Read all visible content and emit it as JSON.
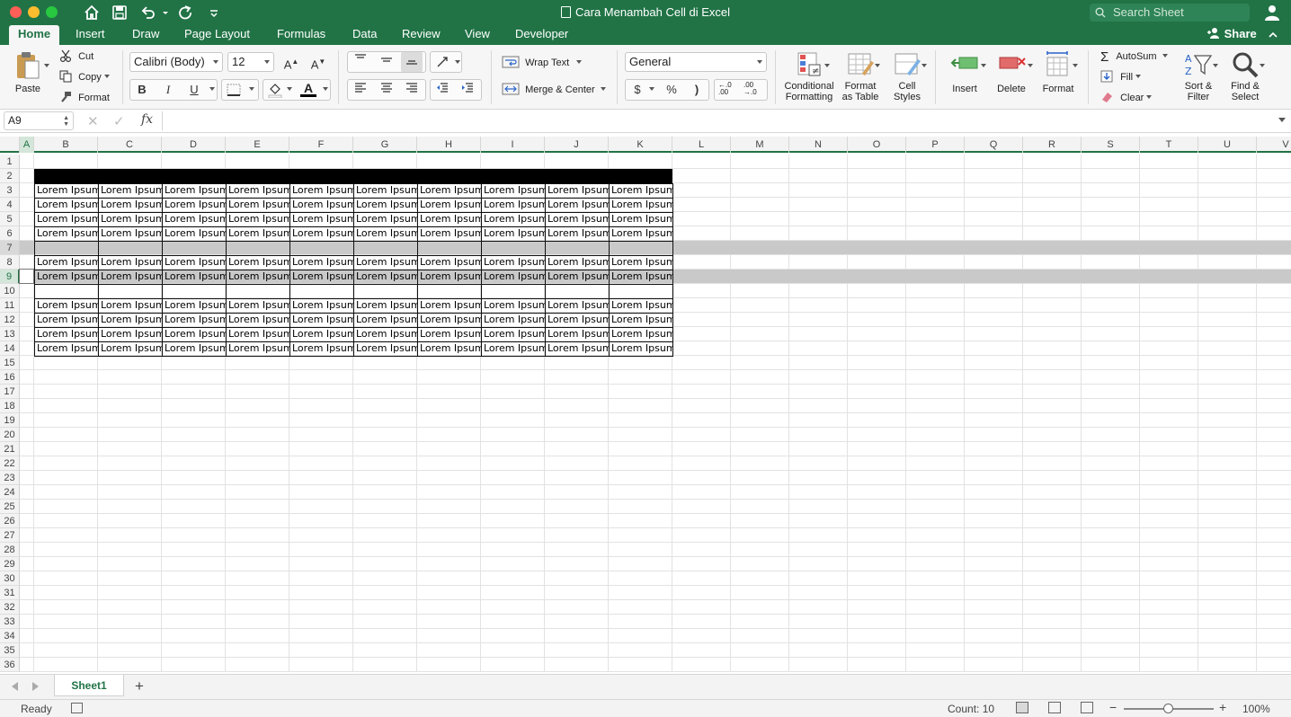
{
  "window": {
    "title": "Cara Menambah Cell di Excel",
    "search_placeholder": "Search Sheet"
  },
  "tabs": [
    "Home",
    "Insert",
    "Draw",
    "Page Layout",
    "Formulas",
    "Data",
    "Review",
    "View",
    "Developer"
  ],
  "share_label": "Share",
  "ribbon": {
    "paste": "Paste",
    "cut": "Cut",
    "copy": "Copy",
    "format_painter": "Format",
    "font_name": "Calibri (Body)",
    "font_size": "12",
    "bold": "B",
    "italic": "I",
    "underline": "U",
    "wrap_text": "Wrap Text",
    "merge_center": "Merge & Center",
    "number_format": "General",
    "currency": "$",
    "percent": "%",
    "comma": ")",
    "conditional_formatting": [
      "Conditional",
      "Formatting"
    ],
    "format_as_table": [
      "Format",
      "as Table"
    ],
    "cell_styles": [
      "Cell",
      "Styles"
    ],
    "insert": "Insert",
    "delete": "Delete",
    "format": "Format",
    "autosum": "AutoSum",
    "fill": "Fill",
    "clear": "Clear",
    "sort_filter": [
      "Sort &",
      "Filter"
    ],
    "find_select": [
      "Find &",
      "Select"
    ]
  },
  "formula_bar": {
    "name_box": "A9",
    "fx": "fx",
    "value": ""
  },
  "columns": [
    "A",
    "B",
    "C",
    "D",
    "E",
    "F",
    "G",
    "H",
    "I",
    "J",
    "K",
    "L",
    "M",
    "N",
    "O",
    "P",
    "Q",
    "R",
    "S",
    "T",
    "U",
    "V"
  ],
  "rows": [
    "1",
    "2",
    "3",
    "4",
    "5",
    "6",
    "7",
    "8",
    "9",
    "10",
    "11",
    "12",
    "13",
    "14",
    "15",
    "16",
    "17",
    "18",
    "19",
    "20",
    "21",
    "22",
    "23",
    "24",
    "25",
    "26",
    "27",
    "28",
    "29",
    "30",
    "31",
    "32",
    "33",
    "34",
    "35",
    "36"
  ],
  "cell_text": "Lorem Ipsum",
  "table": {
    "header_row": 2,
    "filled_rows": [
      3,
      4,
      5,
      6,
      8,
      9,
      11,
      12,
      13,
      14
    ],
    "empty_bordered_rows": [
      7,
      10
    ],
    "highlighted_rows": [
      7,
      9
    ],
    "first_col": "B",
    "last_col": "K"
  },
  "selected_cell": "A9",
  "sheets": [
    {
      "name": "Sheet1",
      "active": true
    }
  ],
  "status": {
    "ready": "Ready",
    "count": "Count: 10",
    "zoom": "100%"
  },
  "colors": {
    "accent": "#217346",
    "highlight_row": "#c9c9c9"
  }
}
